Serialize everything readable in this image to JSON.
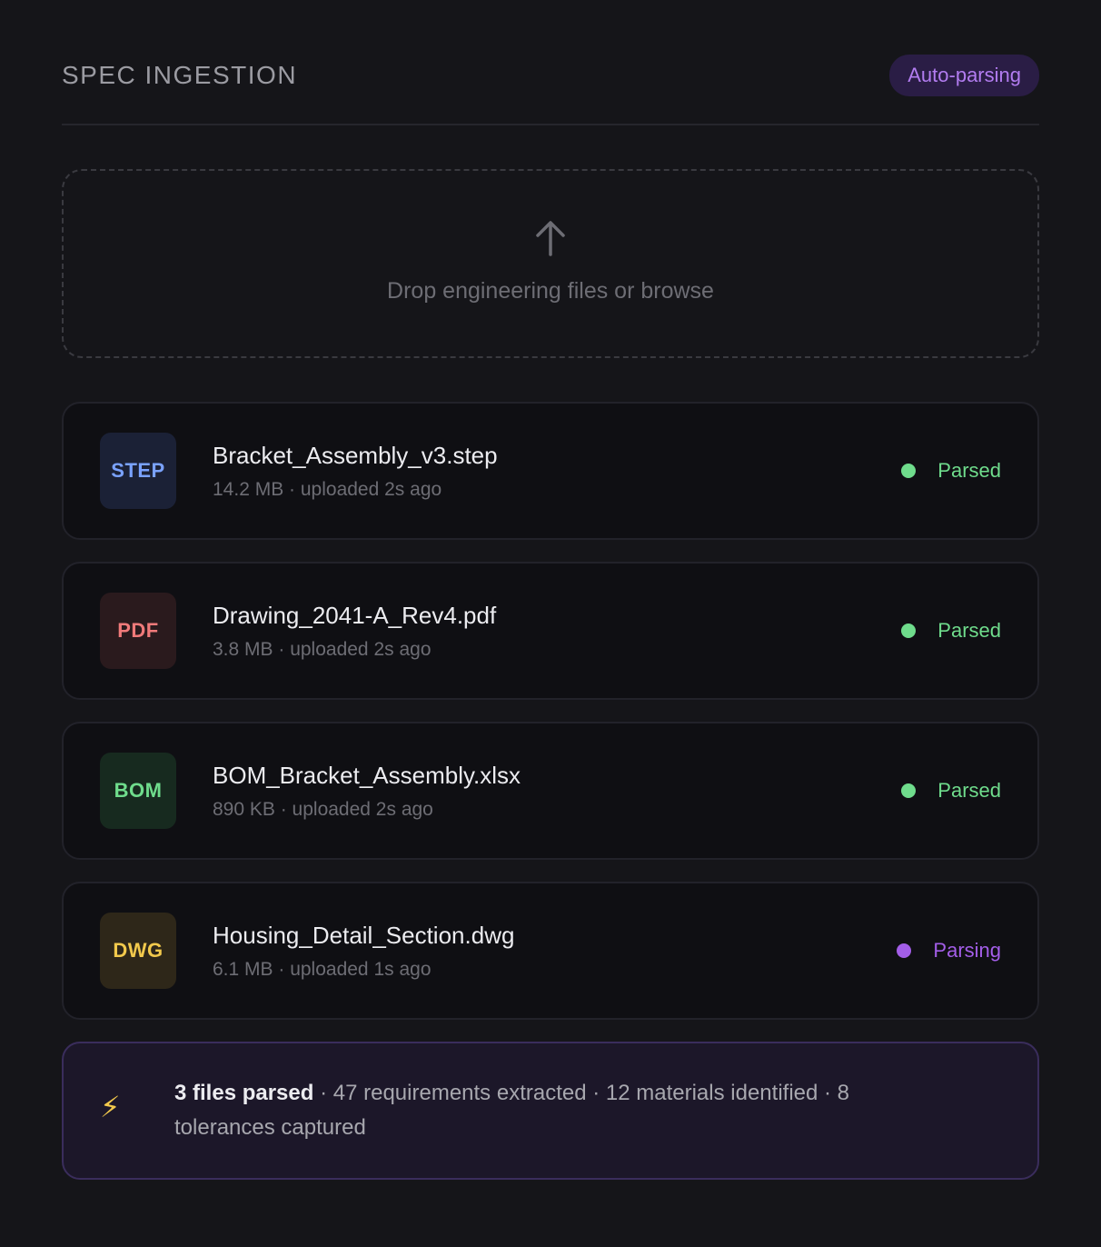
{
  "header": {
    "title": "SPEC INGESTION",
    "badge": "Auto-parsing"
  },
  "dropzone": {
    "icon": "arrow-up-icon",
    "text": "Drop engineering files or browse"
  },
  "files": [
    {
      "type": "STEP",
      "name": "Bracket_Assembly_v3.step",
      "meta": "14.2 MB · uploaded 2s ago",
      "status": "Parsed",
      "type_color": "#7aa2ff",
      "type_bg": "#1b2136",
      "status_color": "#6fdc8c"
    },
    {
      "type": "PDF",
      "name": "Drawing_2041-A_Rev4.pdf",
      "meta": "3.8 MB · uploaded 2s ago",
      "status": "Parsed",
      "type_color": "#f07a7a",
      "type_bg": "#2a1a1d",
      "status_color": "#6fdc8c"
    },
    {
      "type": "BOM",
      "name": "BOM_Bracket_Assembly.xlsx",
      "meta": "890 KB · uploaded 2s ago",
      "status": "Parsed",
      "type_color": "#6fdc8c",
      "type_bg": "#172a1f",
      "status_color": "#6fdc8c"
    },
    {
      "type": "DWG",
      "name": "Housing_Detail_Section.dwg",
      "meta": "6.1 MB · uploaded 1s ago",
      "status": "Parsing",
      "type_color": "#f2c94c",
      "type_bg": "#2e2719",
      "status_color": "#a35ee8"
    }
  ],
  "summary": {
    "icon": "lightning-icon",
    "bold": "3 files parsed",
    "rest": " · 47 requirements extracted · 12 materials identified · 8 tolerances captured"
  }
}
